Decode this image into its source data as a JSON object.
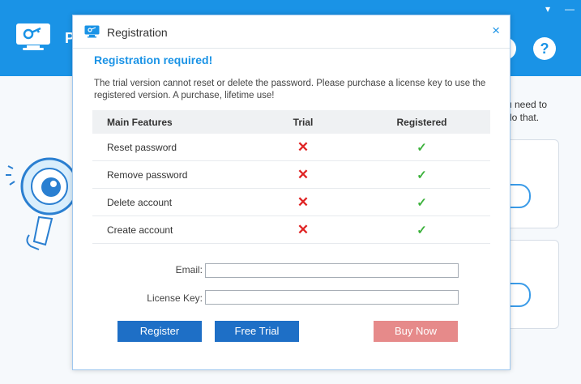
{
  "app": {
    "title_fragment": "P",
    "side_text": "u need to\ndo that.",
    "window_controls": [
      "▾",
      "—"
    ]
  },
  "dialog": {
    "title": "Registration",
    "close_symbol": "×",
    "heading": "Registration required!",
    "description": "The trial version cannot reset or delete the password. Please purchase a license key to use the registered version. A purchase, lifetime use!",
    "table": {
      "headers": [
        "Main Features",
        "Trial",
        "Registered"
      ],
      "rows": [
        {
          "feature": "Reset password",
          "trial": "✕",
          "registered": "✓"
        },
        {
          "feature": "Remove password",
          "trial": "✕",
          "registered": "✓"
        },
        {
          "feature": "Delete account",
          "trial": "✕",
          "registered": "✓"
        },
        {
          "feature": "Create account",
          "trial": "✕",
          "registered": "✓"
        }
      ]
    },
    "form": {
      "email_label": "Email:",
      "email_value": "",
      "license_label": "License Key:",
      "license_value": ""
    },
    "buttons": {
      "register": "Register",
      "free_trial": "Free Trial",
      "buy_now": "Buy Now"
    }
  },
  "colors": {
    "accent": "#1a93e6",
    "button_blue": "#1e6fc6",
    "button_buy": "#e68a8a",
    "cross": "#e02424",
    "check": "#3db23d"
  }
}
